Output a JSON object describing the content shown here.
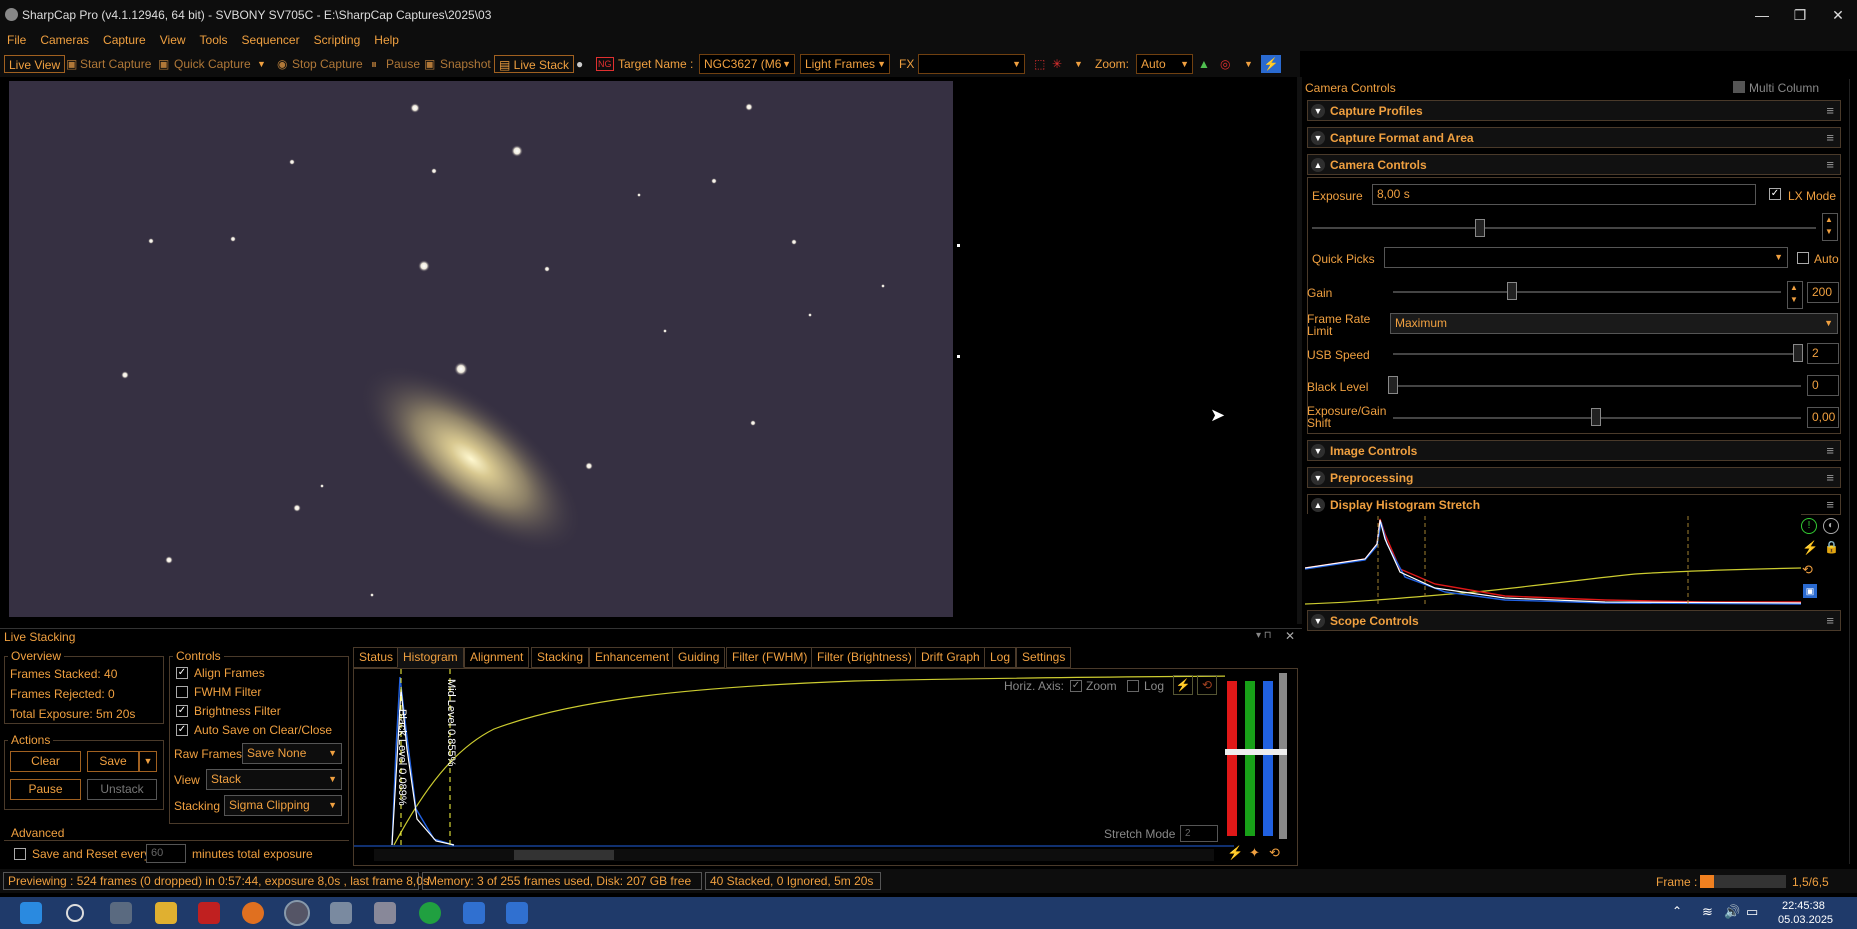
{
  "window": {
    "title": "SharpCap Pro (v4.1.12946, 64 bit) - SVBONY SV705C - E:\\SharpCap Captures\\2025\\03",
    "minimize": "—",
    "maximize": "❐",
    "close": "✕"
  },
  "menu": [
    "File",
    "Cameras",
    "Capture",
    "View",
    "Tools",
    "Sequencer",
    "Scripting",
    "Help"
  ],
  "toolbar": {
    "live_view": "Live View",
    "start_capture": "Start Capture",
    "quick_capture": "Quick Capture",
    "stop_capture": "Stop Capture",
    "pause": "Pause",
    "snapshot": "Snapshot",
    "live_stack": "Live Stack",
    "target_name_label": "Target Name :",
    "target_name_value": "NGC3627 (M6",
    "frame_type": "Light Frames",
    "fx_label": "FX",
    "fx_value": "",
    "zoom_label": "Zoom:",
    "zoom_value": "Auto"
  },
  "camera_controls": {
    "header": "Camera Controls",
    "multi_column": "Multi Column",
    "sections": {
      "capture_profiles": "Capture Profiles",
      "capture_format": "Capture Format and Area",
      "camera_controls": "Camera Controls",
      "image_controls": "Image Controls",
      "preprocessing": "Preprocessing",
      "display_histogram": "Display Histogram Stretch",
      "scope_controls": "Scope Controls"
    },
    "exposure_label": "Exposure",
    "exposure_value": "8,00 s",
    "lx_mode": "LX Mode",
    "quick_picks": "Quick Picks",
    "auto": "Auto",
    "gain_label": "Gain",
    "gain_value": "200",
    "frame_rate_label": "Frame Rate Limit",
    "frame_rate_value": "Maximum",
    "usb_speed_label": "USB Speed",
    "usb_speed_value": "2",
    "black_level_label": "Black Level",
    "black_level_value": "0",
    "exp_gain_shift_label": "Exposure/Gain Shift",
    "exp_gain_shift_value": "0,00"
  },
  "live_stacking": {
    "title": "Live Stacking",
    "overview_title": "Overview",
    "frames_stacked": "Frames Stacked:   40",
    "frames_rejected": "Frames Rejected:  0",
    "total_exposure": "Total Exposure:    5m 20s",
    "actions_title": "Actions",
    "clear": "Clear",
    "save": "Save",
    "pause": "Pause",
    "unstack": "Unstack",
    "advanced_title": "Advanced",
    "save_reset_every": "Save and Reset every",
    "save_reset_value": "60",
    "minutes_total": "minutes total exposure",
    "controls_title": "Controls",
    "align_frames": "Align Frames",
    "fwhm_filter": "FWHM Filter",
    "brightness_filter": "Brightness Filter",
    "auto_save": "Auto Save on Clear/Close",
    "raw_frames_label": "Raw Frames",
    "raw_frames_value": "Save None",
    "view_label": "View",
    "view_value": "Stack",
    "stacking_label": "Stacking",
    "stacking_value": "Sigma Clipping",
    "tabs": [
      "Status",
      "Histogram",
      "Alignment",
      "Stacking",
      "Enhancement",
      "Guiding",
      "Filter (FWHM)",
      "Filter (Brightness)",
      "Drift Graph",
      "Log",
      "Settings"
    ],
    "horiz_axis": "Horiz. Axis:",
    "zoom": "Zoom",
    "log": "Log",
    "black_level_marker": "Black Level 0.089%",
    "mid_level_marker": "Mid Level 0.855%",
    "stretch_mode": "Stretch Mode",
    "stretch_mode_value": "2"
  },
  "status": {
    "previewing": "Previewing : 524 frames (0 dropped) in 0:57:44, exposure 8,0s , last frame 8,0s",
    "memory": "Memory: 3 of 255 frames used, Disk: 207 GB free",
    "stacked": "40 Stacked, 0 Ignored, 5m 20s",
    "frame_label": "Frame :",
    "frame_value": "1,5/6,5"
  },
  "taskbar": {
    "time": "22:45:38",
    "date": "05.03.2025"
  },
  "colors": {
    "accent": "#f0a040",
    "sky": "#363042",
    "taskbar": "#1f3a6a"
  }
}
